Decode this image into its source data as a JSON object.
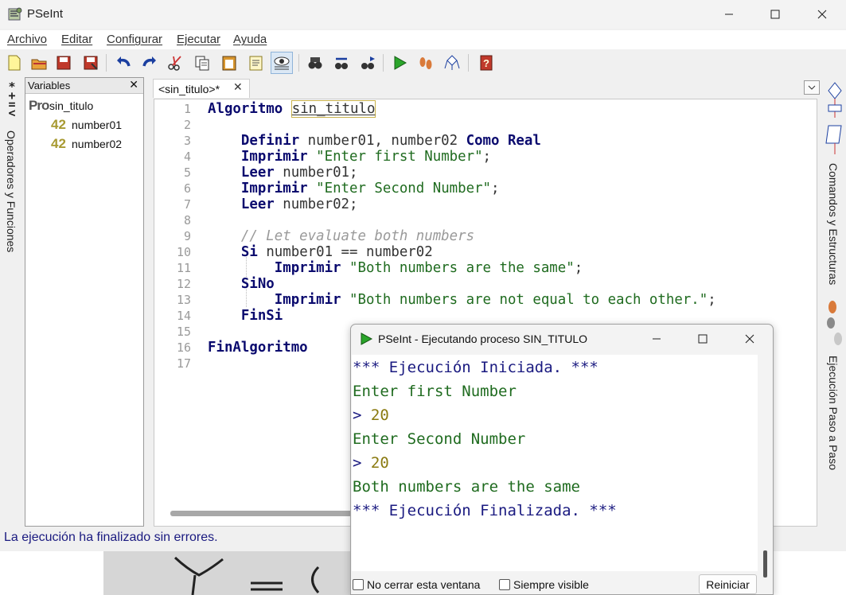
{
  "window": {
    "title": "PSeInt",
    "controls": [
      "minimize",
      "maximize",
      "close"
    ]
  },
  "menu": [
    "Archivo",
    "Editar",
    "Configurar",
    "Ejecutar",
    "Ayuda"
  ],
  "toolbar": {
    "icons": [
      "new-file-icon",
      "open-file-icon",
      "save-icon",
      "save-as-icon",
      "undo-icon",
      "redo-icon",
      "cut-icon",
      "copy-icon",
      "paste-icon",
      "edit-icon",
      "search-eye-icon",
      "find-icon",
      "replace-icon",
      "find-next-icon",
      "run-icon",
      "step-icon",
      "flowchart-icon",
      "help-icon"
    ]
  },
  "left_panel": {
    "symbols": "* + = <",
    "label": "Operadores y Funciones"
  },
  "variables": {
    "title": "Variables",
    "close": "✕",
    "items": [
      {
        "kind": "Pro",
        "name": "sin_titulo"
      },
      {
        "kind": "42",
        "name": "number01"
      },
      {
        "kind": "42",
        "name": "number02"
      }
    ]
  },
  "editor": {
    "tab": "<sin_titulo>*",
    "tab_close": "✕",
    "line_numbers": [
      "1",
      "2",
      "3",
      "4",
      "5",
      "6",
      "7",
      "8",
      "9",
      "10",
      "11",
      "12",
      "13",
      "14",
      "15",
      "16",
      "17"
    ],
    "lines": [
      {
        "parts": [
          {
            "t": "kw",
            "v": "Algoritmo"
          },
          {
            "t": "plain",
            "v": " "
          },
          {
            "t": "name",
            "v": "sin_titulo"
          }
        ]
      },
      {
        "parts": []
      },
      {
        "parts": [
          {
            "t": "plain",
            "v": "    "
          },
          {
            "t": "kw",
            "v": "Definir"
          },
          {
            "t": "plain",
            "v": " number01, number02 "
          },
          {
            "t": "kw",
            "v": "Como Real"
          }
        ]
      },
      {
        "parts": [
          {
            "t": "plain",
            "v": "    "
          },
          {
            "t": "kw",
            "v": "Imprimir"
          },
          {
            "t": "plain",
            "v": " "
          },
          {
            "t": "str",
            "v": "\"Enter first Number\""
          },
          {
            "t": "plain",
            "v": ";"
          }
        ]
      },
      {
        "parts": [
          {
            "t": "plain",
            "v": "    "
          },
          {
            "t": "kw",
            "v": "Leer"
          },
          {
            "t": "plain",
            "v": " number01;"
          }
        ]
      },
      {
        "parts": [
          {
            "t": "plain",
            "v": "    "
          },
          {
            "t": "kw",
            "v": "Imprimir"
          },
          {
            "t": "plain",
            "v": " "
          },
          {
            "t": "str",
            "v": "\"Enter Second Number\""
          },
          {
            "t": "plain",
            "v": ";"
          }
        ]
      },
      {
        "parts": [
          {
            "t": "plain",
            "v": "    "
          },
          {
            "t": "kw",
            "v": "Leer"
          },
          {
            "t": "plain",
            "v": " number02;"
          }
        ]
      },
      {
        "parts": []
      },
      {
        "parts": [
          {
            "t": "plain",
            "v": "    "
          },
          {
            "t": "cmt",
            "v": "// Let evaluate both numbers"
          }
        ]
      },
      {
        "parts": [
          {
            "t": "plain",
            "v": "    "
          },
          {
            "t": "kw",
            "v": "Si"
          },
          {
            "t": "plain",
            "v": " number01 == number02"
          }
        ]
      },
      {
        "parts": [
          {
            "t": "plain",
            "v": "        "
          },
          {
            "t": "kw",
            "v": "Imprimir"
          },
          {
            "t": "plain",
            "v": " "
          },
          {
            "t": "str",
            "v": "\"Both numbers are the same\""
          },
          {
            "t": "plain",
            "v": ";"
          }
        ]
      },
      {
        "parts": [
          {
            "t": "plain",
            "v": "    "
          },
          {
            "t": "kw",
            "v": "SiNo"
          }
        ]
      },
      {
        "parts": [
          {
            "t": "plain",
            "v": "        "
          },
          {
            "t": "kw",
            "v": "Imprimir"
          },
          {
            "t": "plain",
            "v": " "
          },
          {
            "t": "str",
            "v": "\"Both numbers are not equal to each other.\""
          },
          {
            "t": "plain",
            "v": ";"
          }
        ]
      },
      {
        "parts": [
          {
            "t": "plain",
            "v": "    "
          },
          {
            "t": "kw",
            "v": "FinSi"
          }
        ]
      },
      {
        "parts": []
      },
      {
        "parts": [
          {
            "t": "kw",
            "v": "FinAlgoritmo"
          }
        ]
      },
      {
        "parts": []
      }
    ]
  },
  "right_panel": {
    "label_top": "Comandos y Estructuras",
    "label_bottom": "Ejecución Paso a Paso"
  },
  "status": "La ejecución ha finalizado sin errores.",
  "run_window": {
    "title": "PSeInt - Ejecutando proceso SIN_TITULO",
    "output": [
      {
        "type": "sys",
        "text": "*** Ejecución Iniciada. ***"
      },
      {
        "type": "out",
        "text": "Enter first Number"
      },
      {
        "type": "in",
        "prompt": "> ",
        "text": "20"
      },
      {
        "type": "out",
        "text": "Enter Second Number"
      },
      {
        "type": "in",
        "prompt": "> ",
        "text": "20"
      },
      {
        "type": "out",
        "text": "Both numbers are the same"
      },
      {
        "type": "sys",
        "text": "*** Ejecución Finalizada. ***"
      }
    ],
    "checkbox_keep_open": "No cerrar esta ventana",
    "checkbox_always_visible": "Siempre visible",
    "restart_button": "Reiniciar"
  },
  "colors": {
    "keyword": "#0a0a6e",
    "string": "#1f6b1f",
    "comment": "#9a9a9a",
    "status": "#1a1a80",
    "input": "#8a7a10"
  }
}
